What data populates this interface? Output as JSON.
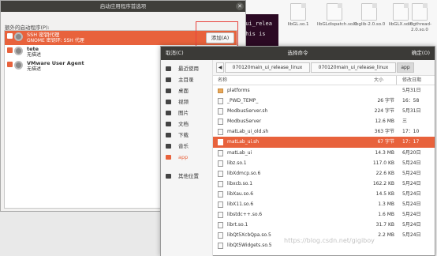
{
  "desktop_files": [
    {
      "label": "libGL.so.1"
    },
    {
      "label": "libGLdispatch.so.0"
    },
    {
      "label": "libglib-2.0.so.0"
    },
    {
      "label": "libGLX.so.0"
    },
    {
      "label": "libgthread-2.0.so.0"
    }
  ],
  "terminal": {
    "line1": "_ui_relea",
    "line2": "This is"
  },
  "startup_dialog": {
    "title": "启动应用程序首选项",
    "close_glyph": "✕",
    "heading": "额外的启动程序(P):",
    "add_button": "添加(A)",
    "items": [
      {
        "name": "SSH 密钥代理",
        "desc": "GNOME 密钥环: SSH 代理"
      },
      {
        "name": "tete",
        "desc": "无描述"
      },
      {
        "name": "VMware User Agent",
        "desc": "无描述"
      }
    ]
  },
  "chooser": {
    "title": "选择命令",
    "cancel": "取消(C)",
    "ok": "确定(O)",
    "places": [
      {
        "label": "最近使用",
        "icon": "clock-icon"
      },
      {
        "label": "主目录",
        "icon": "home-icon"
      },
      {
        "label": "桌面",
        "icon": "desktop-icon"
      },
      {
        "label": "视频",
        "icon": "video-icon"
      },
      {
        "label": "图片",
        "icon": "picture-icon"
      },
      {
        "label": "文档",
        "icon": "document-icon"
      },
      {
        "label": "下载",
        "icon": "download-icon"
      },
      {
        "label": "音乐",
        "icon": "music-icon"
      },
      {
        "label": "app",
        "icon": "folder-icon"
      },
      {
        "label": "其他位置",
        "icon": "plus-icon"
      }
    ],
    "nav_back": "◀",
    "path": [
      "070120main_ui_release_linux",
      "070120main_ui_release_linux",
      "app"
    ],
    "columns": {
      "name": "名称",
      "size": "大小",
      "modified": "修改日期"
    },
    "files": [
      {
        "name": "platforms",
        "size": "",
        "modified": "5月31日",
        "type": "folder"
      },
      {
        "name": "_PWD_TEMP_",
        "size": "26 字节",
        "modified": "16：58",
        "type": "file"
      },
      {
        "name": "ModbusServer.sh",
        "size": "224 字节",
        "modified": "5月31日",
        "type": "file"
      },
      {
        "name": "ModbusServer",
        "size": "12.6 MB",
        "modified": "三",
        "type": "file"
      },
      {
        "name": "matLab_ui_old.sh",
        "size": "363 字节",
        "modified": "17：10",
        "type": "file"
      },
      {
        "name": "matLab_ui.sh",
        "size": "67 字节",
        "modified": "17：17",
        "type": "file"
      },
      {
        "name": "matLab_ui",
        "size": "14.3 MB",
        "modified": "6月20日",
        "type": "file"
      },
      {
        "name": "libz.so.1",
        "size": "117.0 KB",
        "modified": "5月24日",
        "type": "file"
      },
      {
        "name": "libXdmcp.so.6",
        "size": "22.6 KB",
        "modified": "5月24日",
        "type": "file"
      },
      {
        "name": "libxcb.so.1",
        "size": "162.2 KB",
        "modified": "5月24日",
        "type": "file"
      },
      {
        "name": "libXau.so.6",
        "size": "14.5 KB",
        "modified": "5月24日",
        "type": "file"
      },
      {
        "name": "libX11.so.6",
        "size": "1.3 MB",
        "modified": "5月24日",
        "type": "file"
      },
      {
        "name": "libstdc++.so.6",
        "size": "1.6 MB",
        "modified": "5月24日",
        "type": "file"
      },
      {
        "name": "librt.so.1",
        "size": "31.7 KB",
        "modified": "5月24日",
        "type": "file"
      },
      {
        "name": "libQt5XcbQpa.so.5",
        "size": "2.2 MB",
        "modified": "5月24日",
        "type": "file"
      },
      {
        "name": "libQt5Widgets.so.5",
        "size": "",
        "modified": "",
        "type": "file"
      }
    ]
  },
  "colors": {
    "accent": "#e8623c",
    "titlebar": "#3b3a37",
    "highlight_box": "#e8423c"
  },
  "watermark": "https://blog.csdn.net/gigiboy"
}
